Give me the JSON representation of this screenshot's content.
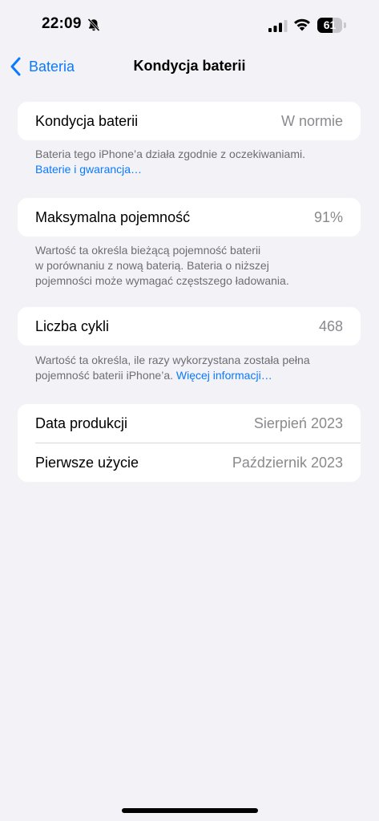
{
  "status_bar": {
    "time": "22:09",
    "battery_level": "61",
    "battery_fraction": 0.61,
    "icons": [
      "bell-slash-icon",
      "cellular-signal-icon",
      "wifi-icon",
      "battery-icon"
    ]
  },
  "nav": {
    "back_label": "Bateria",
    "title": "Kondycja baterii",
    "back_icon": "chevron-left-icon"
  },
  "sections": {
    "condition": {
      "label": "Kondycja baterii",
      "value": "W normie",
      "footnote_text": "Bateria tego iPhone’a działa zgodnie z oczekiwaniami.",
      "footnote_link": "Baterie i gwarancja…"
    },
    "capacity": {
      "label": "Maksymalna pojemność",
      "value": "91%",
      "footnote_line1": "Wartość ta określa bieżącą pojemność baterii",
      "footnote_line2": "w porównaniu z nową baterią. Bateria o niższej",
      "footnote_line3": "pojemności może wymagać częstszego ładowania."
    },
    "cycles": {
      "label": "Liczba cykli",
      "value": "468",
      "footnote_line1": "Wartość ta określa, ile razy wykorzystana została pełna",
      "footnote_line2": "pojemność baterii iPhone’a.",
      "footnote_link": "Więcej informacji…"
    },
    "dates": {
      "manufacture_label": "Data produkcji",
      "manufacture_value": "Sierpień 2023",
      "first_use_label": "Pierwsze użycie",
      "first_use_value": "Październik 2023"
    }
  },
  "colors": {
    "accent": "#0a7aff",
    "background": "#f2f2f7",
    "secondary_text": "#8a8a8e"
  }
}
